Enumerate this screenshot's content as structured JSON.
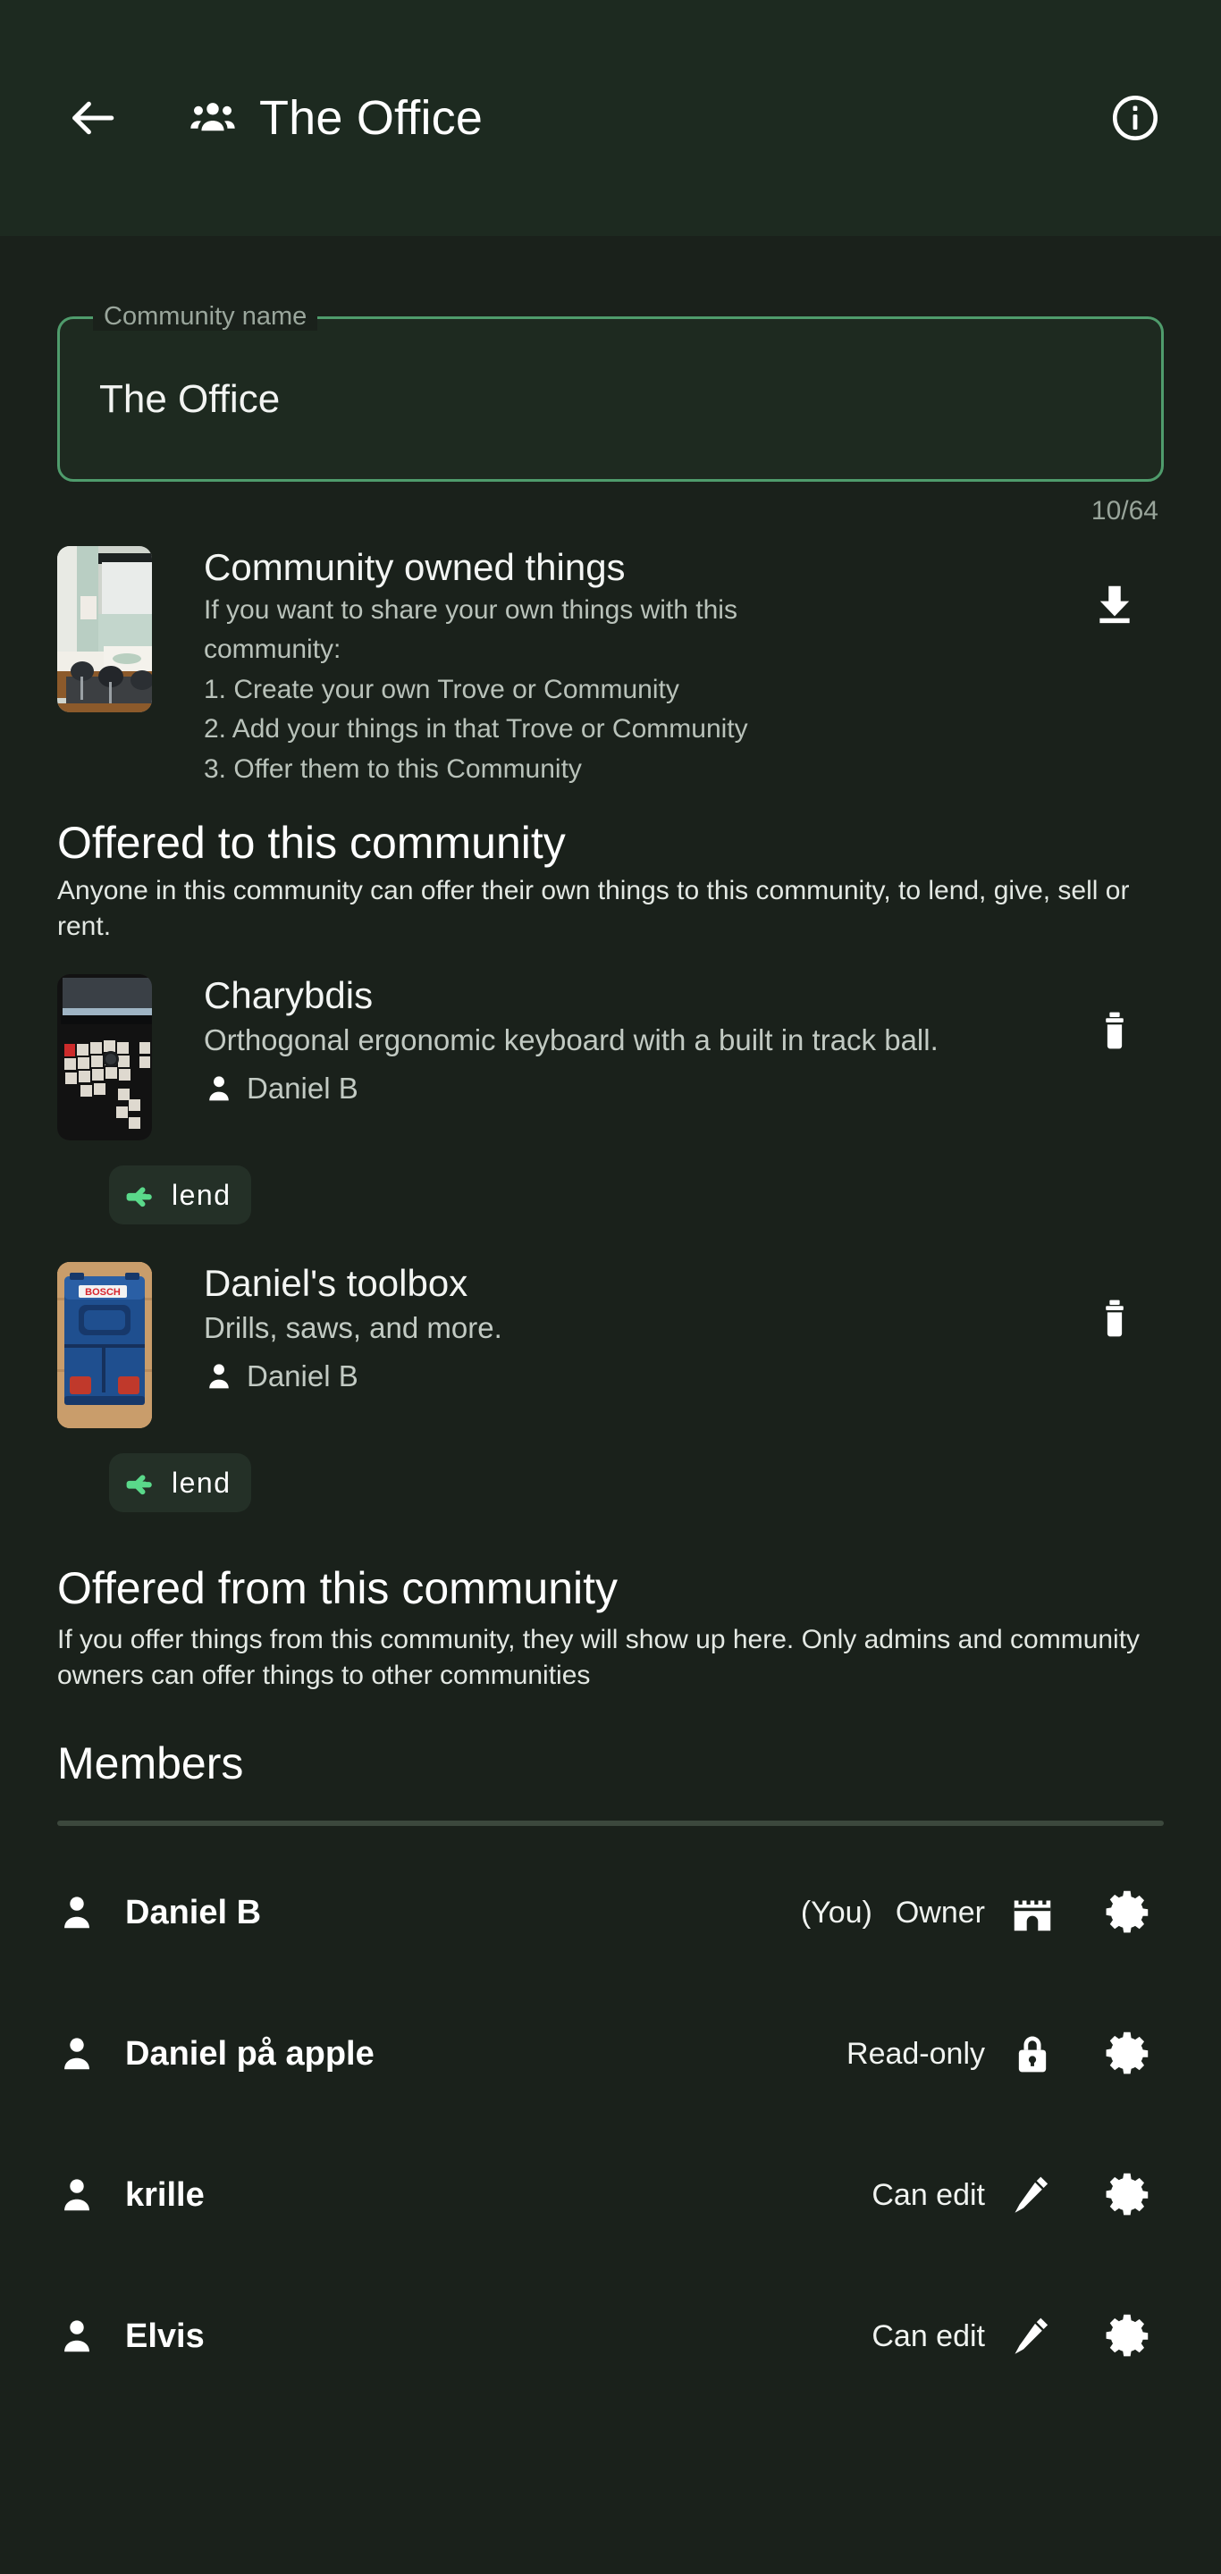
{
  "appbar": {
    "back_icon": "arrow-back-icon",
    "group_icon": "people-group-icon",
    "title": "The Office",
    "info_icon": "info-circle-icon"
  },
  "name_field": {
    "label": "Community name",
    "value": "The Office",
    "placeholder": "Community name",
    "counter": "10/64"
  },
  "community_owned": {
    "title": "Community owned things",
    "description_line1": "If you want to share your own things with this",
    "description_line2": "community:",
    "step1": "1. Create your own Trove or Community",
    "step2": "2. Add your things in that Trove or Community",
    "step3": "3. Offer them to this Community",
    "action_icon": "download-icon",
    "thumbnail_alt": "office-meeting-room-photo"
  },
  "offered_to": {
    "heading": "Offered to this community",
    "subtitle": "Anyone in this community can offer their own things to this community, to lend, give, sell or rent.",
    "items": [
      {
        "title": "Charybdis",
        "description": "Orthogonal ergonomic keyboard with a built in track ball.",
        "owner": "Daniel B",
        "owner_icon": "person-icon",
        "chip_label": "lend",
        "chip_icon": "lend-hand-icon",
        "action_icon": "delete-trash-icon",
        "thumbnail_alt": "split-keyboard-photo"
      },
      {
        "title": "Daniel's toolbox",
        "description": "Drills, saws, and more.",
        "owner": "Daniel B",
        "owner_icon": "person-icon",
        "chip_label": "lend",
        "chip_icon": "lend-hand-icon",
        "action_icon": "delete-trash-icon",
        "thumbnail_alt": "bosch-blue-toolbox-photo"
      }
    ]
  },
  "offered_from": {
    "heading": "Offered from this community",
    "subtitle": "If you offer things from this community, they will show up here. Only admins and community owners can offer things to other communities"
  },
  "members": {
    "heading": "Members",
    "rows": [
      {
        "name": "Daniel B",
        "you_tag": "(You)",
        "role": "Owner",
        "role_icon": "castle-owner-icon",
        "avatar_icon": "person-icon",
        "settings_icon": "gear-icon"
      },
      {
        "name": "Daniel på apple",
        "you_tag": "",
        "role": "Read-only",
        "role_icon": "lock-icon",
        "avatar_icon": "person-icon",
        "settings_icon": "gear-icon"
      },
      {
        "name": "krille",
        "you_tag": "",
        "role": "Can edit",
        "role_icon": "pencil-icon",
        "avatar_icon": "person-icon",
        "settings_icon": "gear-icon"
      },
      {
        "name": "Elvis",
        "you_tag": "",
        "role": "Can edit",
        "role_icon": "pencil-icon",
        "avatar_icon": "person-icon",
        "settings_icon": "gear-icon"
      }
    ]
  },
  "colors": {
    "appbar_bg": "#1d2a20",
    "page_bg": "#1a211b",
    "field_border": "#4f9c6c",
    "chip_icon_green": "#5ad98a",
    "divider": "#3c483d",
    "text_primary": "#ffffff",
    "text_secondary": "#b9c2ba"
  }
}
